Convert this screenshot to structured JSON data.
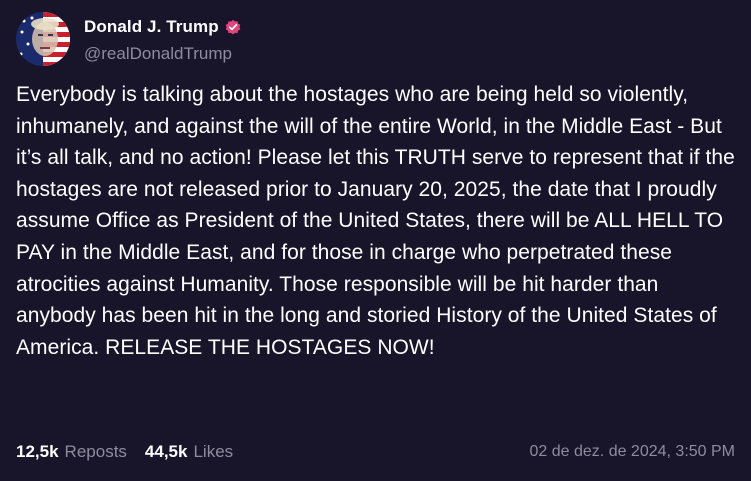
{
  "author": {
    "display_name": "Donald J. Trump",
    "handle": "@realDonaldTrump",
    "verified": true,
    "verified_color": "#e0457b"
  },
  "post": {
    "text": "Everybody is talking about the hostages who are being held so violently, inhumanely, and against the will of the entire World, in the Middle East - But it’s all talk, and no action! Please let this TRUTH serve to represent that if the hostages are not released prior to January 20, 2025, the date that I proudly assume Office as President of the United States, there will be ALL HELL TO PAY in the Middle East, and for those in charge who perpetrated these atrocities against Humanity. Those responsible will be hit harder than anybody has been hit in the long and storied History of the United States of America. RELEASE THE HOSTAGES NOW!"
  },
  "stats": {
    "reposts_count": "12,5k",
    "reposts_label": "Reposts",
    "likes_count": "44,5k",
    "likes_label": "Likes"
  },
  "timestamp": "02 de dez. de 2024, 3:50 PM",
  "colors": {
    "background": "#18152b",
    "text": "#ffffff",
    "muted": "#8e8b9e"
  }
}
